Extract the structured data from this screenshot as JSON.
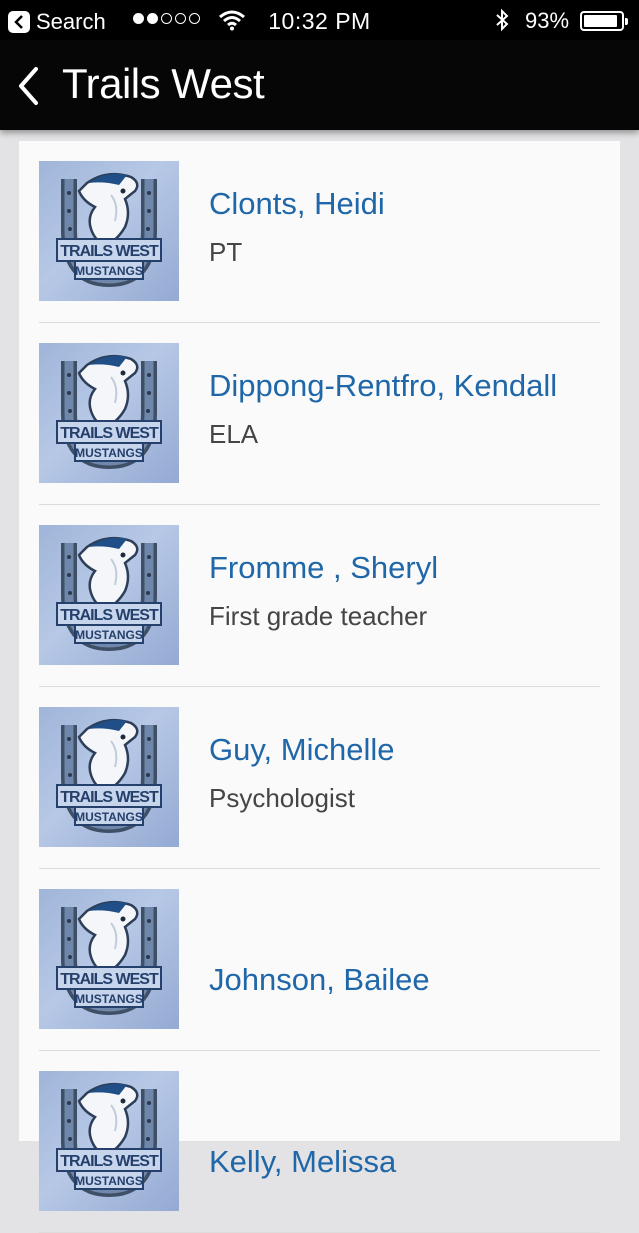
{
  "status_bar": {
    "back_app_label": "Search",
    "signal_bars": 2,
    "signal_total": 5,
    "time": "10:32 PM",
    "battery_percent": "93%",
    "battery_level": 0.93
  },
  "nav": {
    "title": "Trails West"
  },
  "logo": {
    "line1": "TRAILS WEST",
    "line2": "MUSTANGS"
  },
  "staff": [
    {
      "name": "Clonts, Heidi",
      "role": "PT"
    },
    {
      "name": "Dippong-Rentfro, Kendall",
      "role": "ELA"
    },
    {
      "name": "Fromme , Sheryl",
      "role": "First grade teacher"
    },
    {
      "name": "Guy, Michelle",
      "role": "Psychologist"
    },
    {
      "name": "Johnson, Bailee",
      "role": ""
    },
    {
      "name": "Kelly, Melissa",
      "role": ""
    }
  ],
  "colors": {
    "name_link": "#1f67a8",
    "nav_background": "#060606",
    "logo_background": "#a9bde0"
  }
}
